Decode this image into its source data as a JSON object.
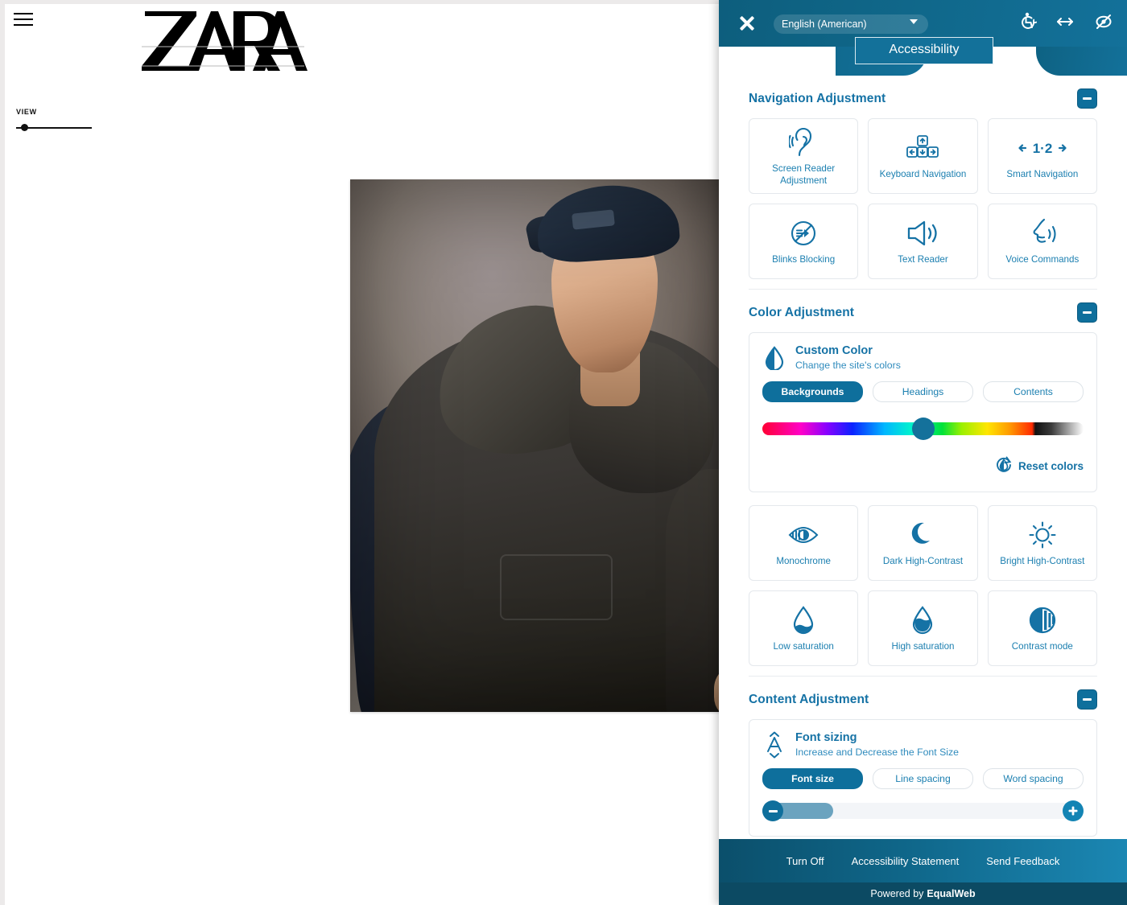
{
  "site": {
    "menu_icon": "hamburger-menu-icon",
    "brand": "ZARA",
    "view_label": "VIEW",
    "photo_alt": "Male model wearing dark hoodie, navy coat and backwards cap"
  },
  "panel": {
    "header": {
      "close_icon": "close-icon",
      "language_value": "English (American)",
      "language_options": [
        "English (American)"
      ],
      "icons": [
        {
          "name": "accessibility-wheelchair-icon"
        },
        {
          "name": "resize-horizontal-icon"
        },
        {
          "name": "hide-interface-icon"
        }
      ]
    },
    "tab_label": "Accessibility",
    "sections": [
      {
        "id": "navigation",
        "title": "Navigation Adjustment",
        "collapse_icon": "minus-icon",
        "tiles": [
          {
            "label": "Screen Reader Adjustment",
            "icon": "ear-sound-icon"
          },
          {
            "label": "Keyboard Navigation",
            "icon": "arrow-keys-icon"
          },
          {
            "label": "Smart Navigation",
            "icon": "smart-nav-1-2-icon"
          },
          {
            "label": "Blinks Blocking",
            "icon": "blink-blocked-icon"
          },
          {
            "label": "Text Reader",
            "icon": "speaker-icon"
          },
          {
            "label": "Voice Commands",
            "icon": "voice-profile-icon"
          }
        ]
      },
      {
        "id": "color",
        "title": "Color Adjustment",
        "collapse_icon": "minus-icon",
        "custom_color": {
          "icon": "contrast-droplet-icon",
          "title": "Custom Color",
          "subtitle": "Change the site's colors",
          "pills": [
            {
              "label": "Backgrounds",
              "active": true
            },
            {
              "label": "Headings",
              "active": false
            },
            {
              "label": "Contents",
              "active": false
            }
          ],
          "slider_position_pct": 50,
          "knob_color": "#14719b",
          "reset_label": "Reset colors",
          "reset_icon": "reset-colors-icon"
        },
        "tiles": [
          {
            "label": "Monochrome",
            "icon": "eye-monochrome-icon"
          },
          {
            "label": "Dark High-Contrast",
            "icon": "moon-icon"
          },
          {
            "label": "Bright High-Contrast",
            "icon": "sun-icon"
          },
          {
            "label": "Low saturation",
            "icon": "droplet-low-icon"
          },
          {
            "label": "High saturation",
            "icon": "droplet-high-icon"
          },
          {
            "label": "Contrast mode",
            "icon": "contrast-circle-icon"
          }
        ]
      },
      {
        "id": "content",
        "title": "Content Adjustment",
        "collapse_icon": "minus-icon",
        "font_sizing": {
          "icon": "font-size-a-icon",
          "title": "Font sizing",
          "subtitle": "Increase and Decrease the Font Size",
          "pills": [
            {
              "label": "Font size",
              "active": true
            },
            {
              "label": "Line spacing",
              "active": false
            },
            {
              "label": "Word spacing",
              "active": false
            }
          ],
          "decrease_icon": "minus-icon",
          "increase_icon": "plus-icon",
          "fill_pct": 22
        }
      }
    ],
    "footer": {
      "links": [
        "Turn Off",
        "Accessibility Statement",
        "Send Feedback"
      ],
      "credit_prefix": "Powered by",
      "credit_brand": "EqualWeb"
    }
  },
  "colors": {
    "brand_blue": "#13719a",
    "accent_dark": "#0c4a63",
    "label_blue": "#1b7fb0",
    "title_blue": "#1572a5"
  }
}
